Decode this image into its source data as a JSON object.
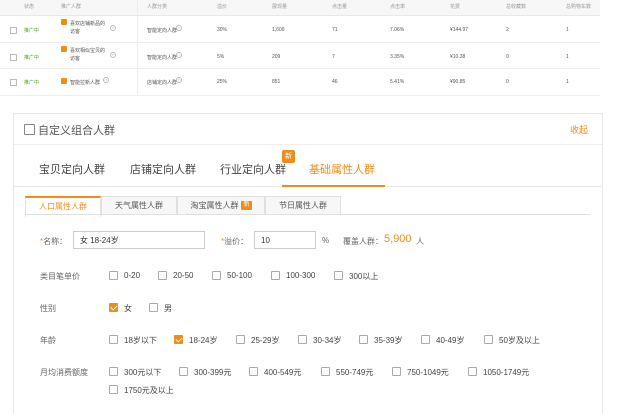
{
  "table": {
    "headers": [
      "状态",
      "推广人群",
      "人群分类",
      "溢价",
      "展现量",
      "点击量",
      "点击率",
      "花费",
      "总收藏数",
      "总购物车数"
    ],
    "rows": [
      {
        "status": "推广中",
        "name_line1": "喜欢店铺新品的",
        "name_line2": "访客",
        "category": "智能定向人群",
        "premium": "30%",
        "impressions": "1,609",
        "clicks": "71",
        "ctr": "7.06%",
        "cost": "¥144.97",
        "fav": "2",
        "cart": "1"
      },
      {
        "status": "推广中",
        "name_line1": "喜欢相似宝贝的",
        "name_line2": "访客",
        "category": "智能定向人群",
        "premium": "5%",
        "impressions": "209",
        "clicks": "7",
        "ctr": "3.35%",
        "cost": "¥10.38",
        "fav": "0",
        "cart": "1"
      },
      {
        "status": "推广中",
        "name_line1": "智能拉新人群",
        "name_line2": "",
        "category": "店铺定向人群",
        "premium": "25%",
        "impressions": "851",
        "clicks": "46",
        "ctr": "5.41%",
        "cost": "¥90.85",
        "fav": "0",
        "cart": "1"
      }
    ]
  },
  "panel": {
    "title": "自定义组合人群",
    "collapse": "收起",
    "main_tabs": [
      "宝贝定向人群",
      "店铺定向人群",
      "行业定向人群",
      "基础属性人群"
    ],
    "new_badge": "新",
    "sub_tabs": [
      "人口属性人群",
      "天气属性人群",
      "淘宝属性人群",
      "节日属性人群"
    ],
    "sub_new": "新",
    "name_label": "名称：",
    "name_value": "女 18-24岁",
    "premium_label": "溢价：",
    "premium_value": "10",
    "premium_unit": "%",
    "coverage_label": "覆盖人群：",
    "coverage_value": "5,900",
    "coverage_unit": "人",
    "groups": {
      "price": {
        "label": "类目笔单价",
        "options": [
          "0-20",
          "20-50",
          "50-100",
          "100-300",
          "300以上"
        ]
      },
      "gender": {
        "label": "性别",
        "options": [
          "女",
          "男"
        ]
      },
      "age": {
        "label": "年龄",
        "options": [
          "18岁以下",
          "18-24岁",
          "25-29岁",
          "30-34岁",
          "35-39岁",
          "40-49岁",
          "50岁及以上"
        ]
      },
      "spend": {
        "label": "月均消费额度",
        "options": [
          "300元以下",
          "300-399元",
          "400-549元",
          "550-749元",
          "750-1049元",
          "1050-1749元",
          "1750元及以上"
        ]
      }
    }
  },
  "colors": {
    "accent": "#f08c1b",
    "status": "#5a9e2f"
  }
}
